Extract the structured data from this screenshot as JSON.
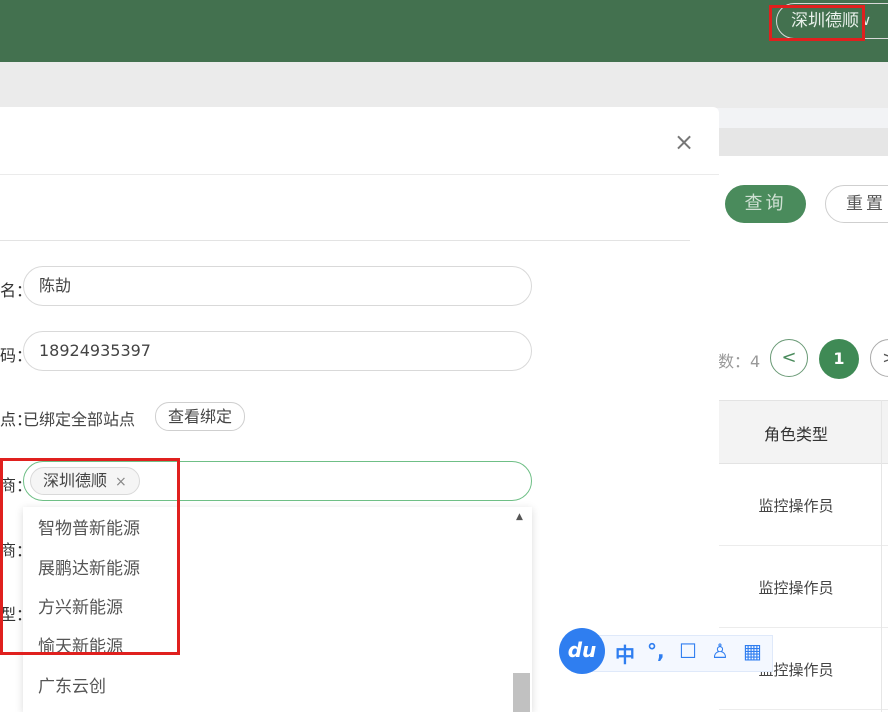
{
  "header": {
    "company_selector": "深圳德顺",
    "chevron": "∨"
  },
  "toolbar": {
    "query_label": "查询",
    "reset_label": "重置"
  },
  "pagination": {
    "total_text": "数：4",
    "prev": "<",
    "current_page": "1",
    "next": ">"
  },
  "table": {
    "column_header": "角色类型",
    "rows": [
      "监控操作员",
      "监控操作员",
      "监控操作员"
    ]
  },
  "modal": {
    "close_icon": "×",
    "fields": {
      "name_label_tail": "名：",
      "name_value": "陈劼",
      "phone_label_tail": "码：",
      "phone_value": "18924935397",
      "station_label_tail": "点：",
      "station_text": "已绑定全部站点",
      "view_binding_button": "查看绑定",
      "company_label_tail": "商：",
      "selected_tag": "深圳德顺",
      "tag_remove": "×",
      "hidden_label_1": "商：",
      "hidden_label_2": "型："
    },
    "dropdown_options": [
      "智物普新能源",
      "展鹏达新能源",
      "方兴新能源",
      "愉天新能源",
      "广东云创"
    ]
  },
  "ime_toolbar": {
    "logo": "du",
    "items": [
      "中",
      "°,",
      "☐",
      "♙",
      "▦"
    ]
  },
  "colors": {
    "header_bg": "#43714f",
    "accent": "#3f8a55",
    "highlight_red": "#e0201e"
  }
}
